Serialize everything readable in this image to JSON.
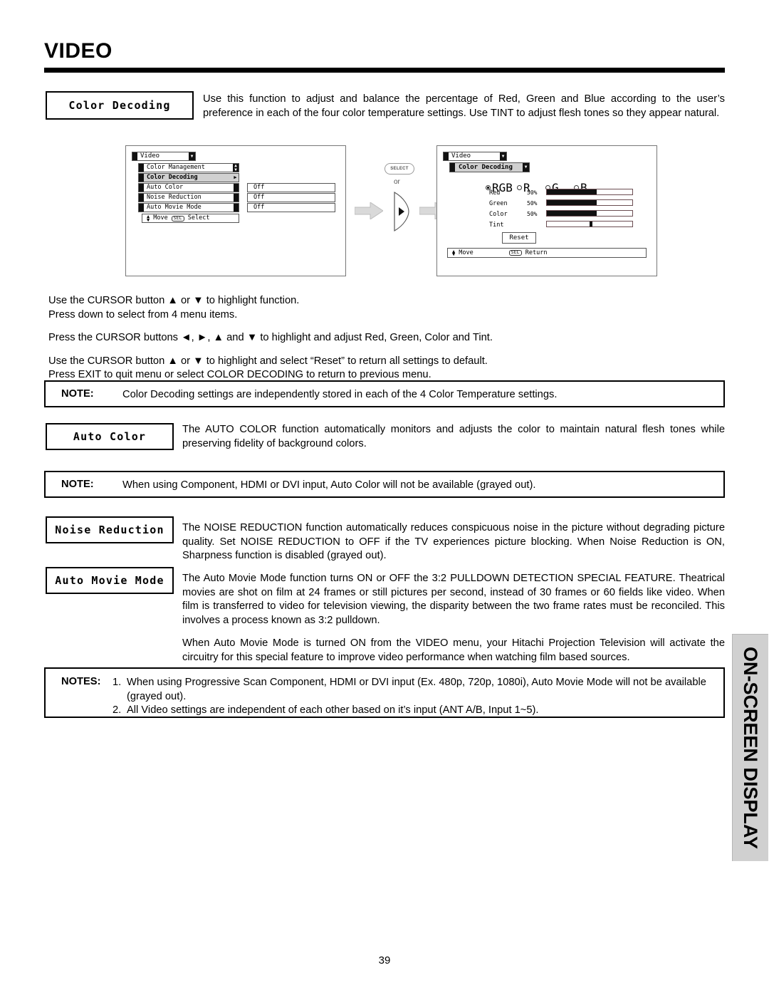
{
  "page": {
    "title": "VIDEO",
    "number": "39",
    "side_tab_label": "ON-SCREEN DISPLAY",
    "accent_gray": "#d0d0d0"
  },
  "sections": [
    {
      "label": "Color Decoding",
      "body": "Use this function to adjust and balance the percentage of Red, Green and Blue according to the user’s preference in each of the four color temperature settings.  Use TINT to adjust flesh tones so they appear natural."
    },
    {
      "label": "Auto Color",
      "body": "The AUTO COLOR function automatically monitors and adjusts the color to maintain natural flesh tones while preserving fidelity of background colors."
    },
    {
      "label": "Noise Reduction",
      "body": "The NOISE REDUCTION function automatically reduces conspicuous noise in the picture without degrading picture quality.  Set NOISE REDUCTION to OFF if the TV experiences picture blocking.  When Noise Reduction is ON, Sharpness function is disabled (grayed out)."
    },
    {
      "label": "Auto Movie Mode",
      "body_p1": "The Auto Movie Mode function turns ON or OFF the 3:2 PULLDOWN DETECTION SPECIAL FEATURE.  Theatrical movies are shot on film at 24 frames or still pictures per second, instead of 30 frames or 60 fields like video.  When film is transferred to video for television viewing, the disparity between the two frame rates must be reconciled.  This involves a process known as 3:2 pulldown.",
      "body_p2": "When Auto Movie Mode is turned ON from the VIDEO menu, your Hitachi Projection Television will activate the circuitry for this special feature to improve video performance when watching film based sources."
    }
  ],
  "instructions": {
    "line1": "Use the CURSOR button ▲ or ▼ to highlight function.",
    "line2": "Press down to select from 4 menu items.",
    "line3": "Press the CURSOR buttons ◄, ►, ▲ and ▼ to highlight and adjust Red, Green, Color and Tint.",
    "line4": "Use the CURSOR button ▲ or ▼ to highlight and select “Reset” to return all settings to default.",
    "line5": "Press EXIT to quit menu or select COLOR DECODING to return to previous menu."
  },
  "notes": {
    "note1": {
      "label": "NOTE:",
      "text": "Color Decoding settings are independently stored in each of the 4 Color Temperature settings."
    },
    "note2": {
      "label": "NOTE:",
      "text": "When using Component, HDMI or DVI input, Auto Color will not be available (grayed out)."
    },
    "notes_multi": {
      "label": "NOTES:",
      "items": [
        {
          "num": "1.",
          "text": "When using Progressive Scan Component, HDMI or DVI input (Ex. 480p, 720p, 1080i), Auto Movie Mode will not be available (grayed out)."
        },
        {
          "num": "2.",
          "text": "All Video settings are independent of each other based on it’s input (ANT A/B, Input 1~5)."
        }
      ]
    }
  },
  "diagram": {
    "connector": {
      "select_key": "SELECT",
      "or": "or"
    },
    "osd_left": {
      "title": "Video",
      "rows": [
        {
          "label": "Color Management",
          "value": "",
          "state": "scroll"
        },
        {
          "label": "Color Decoding",
          "value": "",
          "state": "selected"
        },
        {
          "label": "Auto Color",
          "value": "Off",
          "state": "normal"
        },
        {
          "label": "Noise Reduction",
          "value": "Off",
          "state": "normal"
        },
        {
          "label": "Auto Movie Mode",
          "value": "Off",
          "state": "normal"
        }
      ],
      "footer": {
        "move": "Move",
        "sel": "SEL",
        "action": "Select"
      }
    },
    "osd_right": {
      "title": "Video",
      "subtitle": "Color Decoding",
      "radios": [
        {
          "label": "RGB",
          "selected": true
        },
        {
          "label": "R",
          "selected": false
        },
        {
          "label": "G",
          "selected": false
        },
        {
          "label": "B",
          "selected": false
        }
      ],
      "sliders": [
        {
          "label": "Red",
          "percent": "50%",
          "fill": 58,
          "thumb": null
        },
        {
          "label": "Green",
          "percent": "50%",
          "fill": 58,
          "thumb": null
        },
        {
          "label": "Color",
          "percent": "50%",
          "fill": 58,
          "thumb": null
        },
        {
          "label": "Tint",
          "percent": "",
          "fill": 0,
          "thumb": 50
        }
      ],
      "reset_button": "Reset",
      "footer": {
        "move": "Move",
        "sel": "SEL",
        "action": "Return"
      }
    }
  }
}
